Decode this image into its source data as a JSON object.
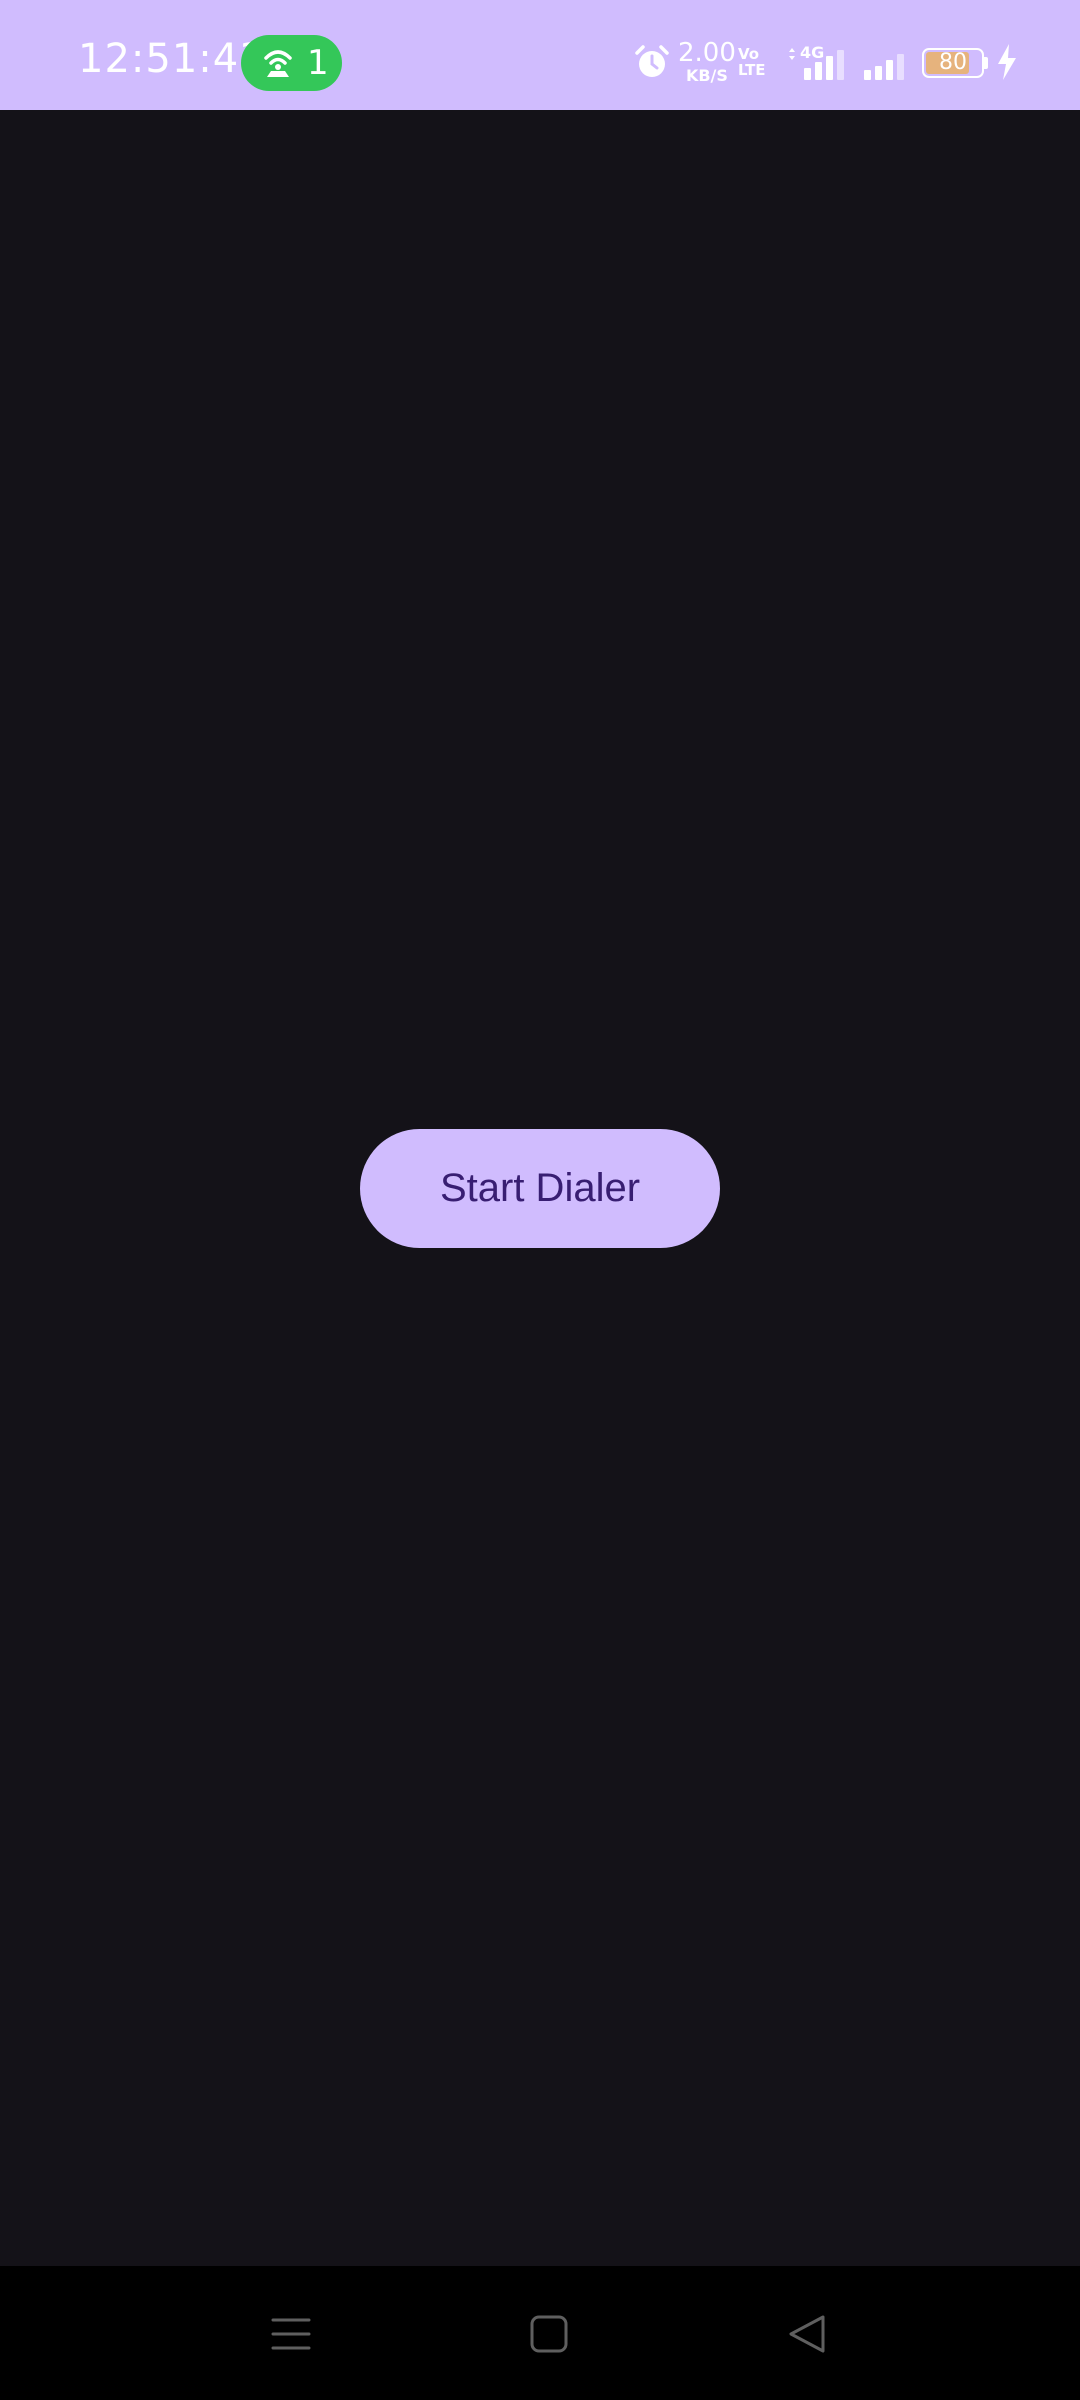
{
  "status_bar": {
    "time": "12:51:43",
    "hotspot_count": "1",
    "net_speed_value": "2.00",
    "net_speed_unit": "KB/S",
    "volte_line1": "Vo",
    "volte_line2": "LTE",
    "network_type": "4G",
    "battery_level": "80",
    "battery_fraction": 0.8,
    "icons": [
      "hotspot-icon",
      "alarm-icon",
      "signal-icon",
      "signal-icon",
      "battery-icon",
      "charging-icon"
    ],
    "colors": {
      "background": "#d0bcfe",
      "hotspot_pill": "#34c759",
      "battery_fill": "#e6b37d"
    }
  },
  "main": {
    "start_button_label": "Start Dialer",
    "colors": {
      "background": "#141218",
      "button_bg": "#d0bcfe",
      "button_text": "#381e72"
    }
  },
  "nav_bar": {
    "buttons": [
      "menu-icon",
      "home-icon",
      "back-icon"
    ]
  }
}
